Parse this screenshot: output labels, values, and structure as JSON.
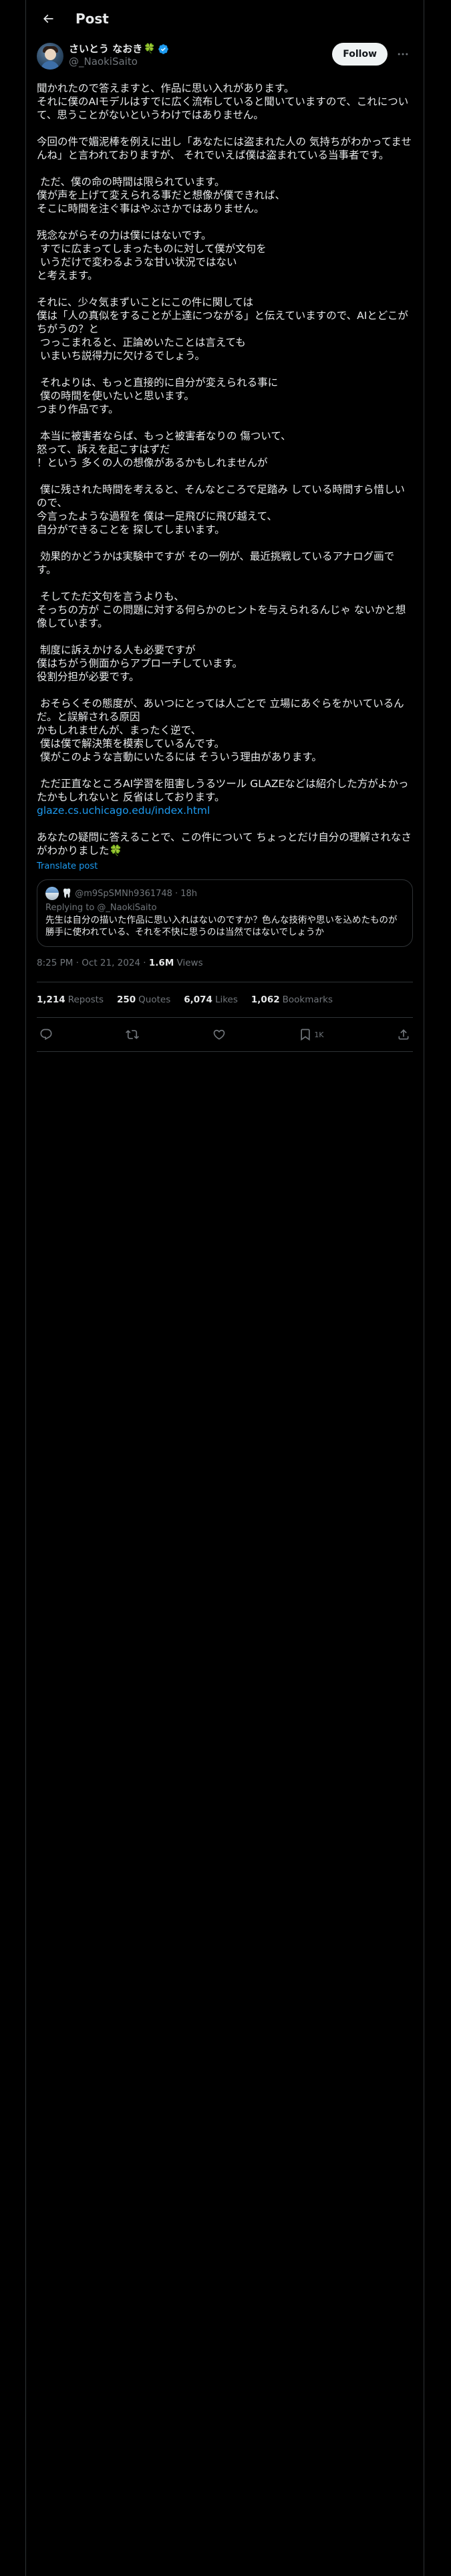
{
  "header": {
    "title": "Post"
  },
  "author": {
    "display_name": "さいとう なおき",
    "badge_emoji": "🍀",
    "handle": "@_NaokiSaito",
    "follow_label": "Follow",
    "verified_color": "#1d9bf0"
  },
  "post": {
    "text": "聞かれたので答えますと、作品に思い入れがあります。\nそれに僕のAIモデルはすでに広く流布していると聞いていますので、これについて、思うことがないというわけではありません。\n\n今回の件で媚泥棒を例えに出し「あなたには盗まれた人の 気持ちがわかってませんね」と言われておりますが、 それでいえば僕は盗まれている当事者です。\n\n ただ、僕の命の時間は限られています。\n僕が声を上げて変えられる事だと想像が僕できれば、\nそこに時間を注ぐ事はやぶさかではありません。\n\n残念ながらその力は僕にはないです。\n すでに広まってしまったものに対して僕が文句を\n いうだけで変わるような甘い状況ではない\nと考えます。\n\nそれに、少々気まずいことにこの件に関しては\n僕は「人の真似をすることが上達につながる」と伝えていますので、AIとどこがちがうの？と\n つっこまれると、正論めいたことは言えても\n いまいち説得力に欠けるでしょう。\n\n それよりは、もっと直接的に自分が変えられる事に\n 僕の時間を使いたいと思います。\nつまり作品です。\n\n 本当に被害者ならば、もっと被害者なりの 傷ついて、\n怒って、訴えを起こすはずだ\n！という 多くの人の想像があるかもしれませんが\n\n 僕に残された時間を考えると、そんなところで足踏み している時間すら惜しいので、\n今言ったような過程を 僕は一足飛びに飛び越えて、\n自分ができることを 探してしまいます。\n\n 効果的かどうかは実験中ですが その一例が、最近挑戦しているアナログ画です。\n\n そしてただ文句を言うよりも、\nそっちの方が この問題に対する何らかのヒントを与えられるんじゃ ないかと想像しています。\n\n 制度に訴えかける人も必要ですが\n僕はちがう側面からアプローチしています。\n役割分担が必要です。\n\n おそらくその態度が、あいつにとっては人ごとで 立場にあぐらをかいているんだ。と誤解される原因\nかもしれませんが、まったく逆で、\n 僕は僕で解決策を模索しているんです。\n 僕がこのような言動にいたるには そういう理由があります。\n\n ただ正直なところAI学習を阻害しうるツール GLAZEなどは紹介した方がよかったかもしれないと 反省はしております。",
    "link": "glaze.cs.uchicago.edu/index.html",
    "text_after": "あなたの疑問に答えることで、この件について ちょっとだけ自分の理解されなさがわかりました🍀",
    "translate_label": "Translate post"
  },
  "quote": {
    "name_emoji": "🦷",
    "handle": "@m9SpSMNh9361748",
    "time": "· 18h",
    "replying_to": "Replying to @_NaokiSaito",
    "text": "先生は自分の描いた作品に思い入れはないのですか？色んな技術や思いを込めたものが勝手に使われている、それを不快に思うのは当然ではないでしょうか"
  },
  "meta": {
    "timestamp": "8:25 PM · Oct 21, 2024 · ",
    "views_count": "1.6M",
    "views_label": " Views"
  },
  "stats": {
    "reposts_count": "1,214",
    "reposts_label": "Reposts",
    "quotes_count": "250",
    "quotes_label": "Quotes",
    "likes_count": "6,074",
    "likes_label": "Likes",
    "bookmarks_count": "1,062",
    "bookmarks_label": "Bookmarks"
  },
  "actions": {
    "bookmark_count": "1K"
  },
  "colors": {
    "background": "#000000",
    "text": "#e7e9ea",
    "muted": "#71767b",
    "accent": "#1d9bf0",
    "border": "#2f3336"
  }
}
